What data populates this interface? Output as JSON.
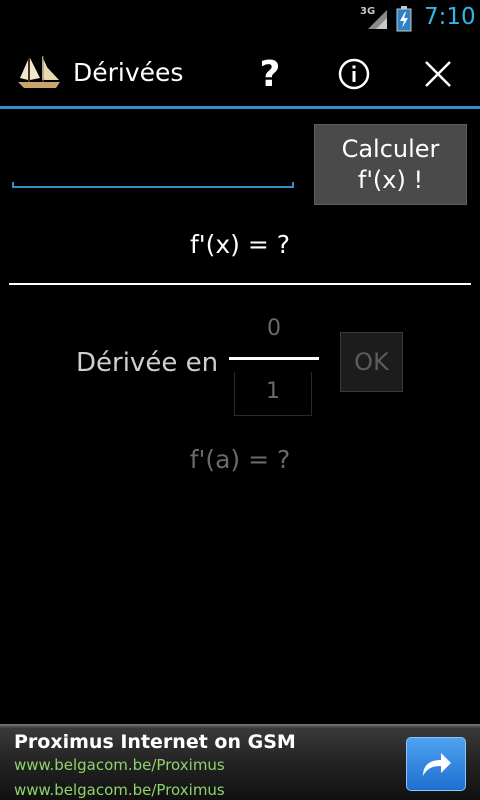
{
  "status_bar": {
    "network": "3G",
    "time": "7:10",
    "icons": [
      "signal-icon",
      "battery-charging-icon"
    ]
  },
  "action_bar": {
    "title": "Dérivées",
    "logo_icon": "sailing-ship-logo",
    "help_label": "?",
    "actions": [
      "help-icon",
      "info-icon",
      "close-icon"
    ]
  },
  "main": {
    "function_input": {
      "value": "",
      "placeholder": ""
    },
    "calculate_button": {
      "line1": "Calculer",
      "line2": "f'(x) !"
    },
    "derivative_result": "f'(x) = ?",
    "evaluate": {
      "label": "Dérivée en",
      "numerator": "0",
      "denominator": "1",
      "ok_label": "OK",
      "result": "f'(a) = ?"
    }
  },
  "ad": {
    "title": "Proximus Internet on GSM",
    "url_1": "www.belgacom.be/Proximus",
    "url_2": "www.belgacom.be/Proximus",
    "action_icon": "share-arrow-icon"
  },
  "colors": {
    "accent": "#33b5e5",
    "divider": "#2c8fc9",
    "ad_link": "#8fd36b"
  }
}
